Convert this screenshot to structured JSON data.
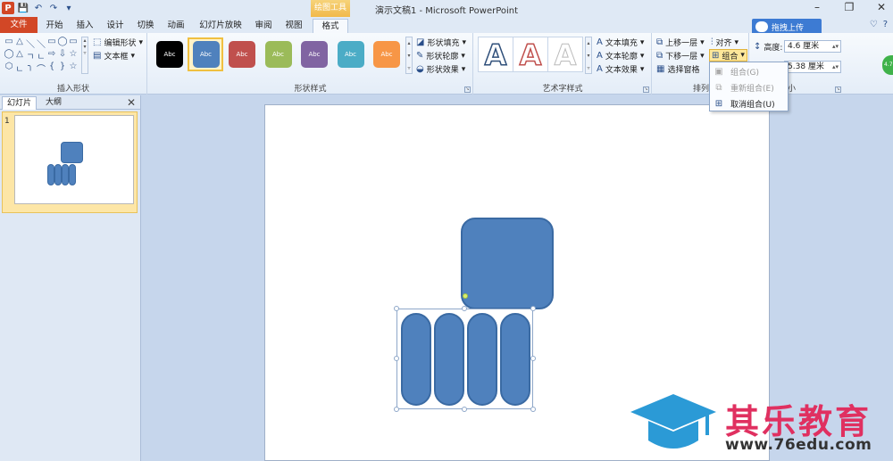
{
  "app": {
    "window_title": "演示文稿1 - Microsoft PowerPoint",
    "context_tab": "绘图工具",
    "window_controls": [
      "–",
      "❐",
      "✕"
    ]
  },
  "qat": [
    "P",
    "💾",
    "↶",
    "↷",
    "▾"
  ],
  "tabs": [
    {
      "label": "文件"
    },
    {
      "label": "开始"
    },
    {
      "label": "插入"
    },
    {
      "label": "设计"
    },
    {
      "label": "切换"
    },
    {
      "label": "动画"
    },
    {
      "label": "幻灯片放映"
    },
    {
      "label": "审阅"
    },
    {
      "label": "视图"
    },
    {
      "label": "格式"
    }
  ],
  "cloud_upload": "拖拽上传",
  "tabs_right": [
    "♡",
    "?"
  ],
  "ribbon": {
    "insert_shapes": {
      "label": "插入形状",
      "shapes": [
        "▭",
        "△",
        "＼",
        "＼",
        "▭",
        "◯",
        "▭",
        "◯",
        "△",
        "ㄱ",
        "ㄴ",
        "⇨",
        "⇩",
        "☆",
        "⬡",
        "ㄴ",
        "╮",
        "⌒",
        "{",
        "}",
        "☆"
      ],
      "edit_shape": "编辑形状",
      "text_box": "文本框"
    },
    "shape_styles": {
      "label": "形状样式",
      "swatch_text": "Abc",
      "swatches": [
        {
          "color": "#000000"
        },
        {
          "color": "#4f81bd"
        },
        {
          "color": "#c0504d"
        },
        {
          "color": "#9bbb59"
        },
        {
          "color": "#8064a2"
        },
        {
          "color": "#4bacc6"
        },
        {
          "color": "#f79646"
        }
      ],
      "fill": "形状填充",
      "outline": "形状轮廓",
      "effects": "形状效果"
    },
    "wordart": {
      "label": "艺术字样式",
      "letter": "A",
      "fill": "文本填充",
      "outline": "文本轮廓",
      "effects": "文本效果"
    },
    "arrange": {
      "label": "排列",
      "bring_forward": "上移一层",
      "send_backward": "下移一层",
      "selection_pane": "选择窗格",
      "align": "对齐",
      "group": "组合"
    },
    "size": {
      "label": "小",
      "height_label": "高度:",
      "height_value": "4.6 厘米",
      "width_value": "5.38 厘米"
    }
  },
  "group_menu": [
    {
      "label": "组合(G)",
      "icon": "▣",
      "enabled": false
    },
    {
      "label": "重新组合(E)",
      "icon": "⧉",
      "enabled": false
    },
    {
      "label": "取消组合(U)",
      "icon": "⊞",
      "enabled": true
    }
  ],
  "left_panel": {
    "tabs": [
      "幻灯片",
      "大纲"
    ],
    "close": "✕",
    "slide_number": "1"
  },
  "watermark": {
    "name": "其乐教育",
    "url": "www.76edu.com"
  },
  "side_badge": "4.7"
}
